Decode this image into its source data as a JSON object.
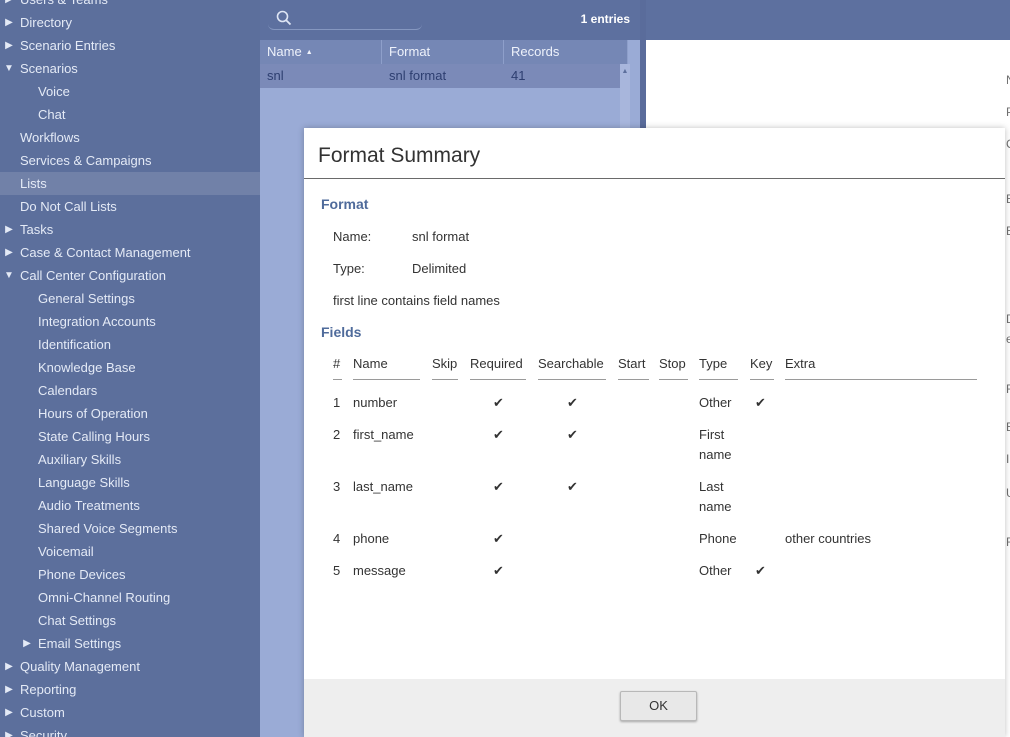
{
  "sidebar": {
    "items": [
      {
        "label": "Users & Teams",
        "arrow": "▶"
      },
      {
        "label": "Directory",
        "arrow": "▶"
      },
      {
        "label": "Scenario Entries",
        "arrow": "▶"
      },
      {
        "label": "Scenarios",
        "arrow": "▼"
      },
      {
        "label": "Voice",
        "arrow": ""
      },
      {
        "label": "Chat",
        "arrow": ""
      },
      {
        "label": "Workflows",
        "arrow": ""
      },
      {
        "label": "Services & Campaigns",
        "arrow": ""
      },
      {
        "label": "Lists",
        "arrow": ""
      },
      {
        "label": "Do Not Call Lists",
        "arrow": ""
      },
      {
        "label": "Tasks",
        "arrow": "▶"
      },
      {
        "label": "Case & Contact Management",
        "arrow": "▶"
      },
      {
        "label": "Call Center Configuration",
        "arrow": "▼"
      },
      {
        "label": "General Settings",
        "arrow": ""
      },
      {
        "label": "Integration Accounts",
        "arrow": ""
      },
      {
        "label": "Identification",
        "arrow": ""
      },
      {
        "label": "Knowledge Base",
        "arrow": ""
      },
      {
        "label": "Calendars",
        "arrow": ""
      },
      {
        "label": "Hours of Operation",
        "arrow": ""
      },
      {
        "label": "State Calling Hours",
        "arrow": ""
      },
      {
        "label": "Auxiliary Skills",
        "arrow": ""
      },
      {
        "label": "Language Skills",
        "arrow": ""
      },
      {
        "label": "Audio Treatments",
        "arrow": ""
      },
      {
        "label": "Shared Voice Segments",
        "arrow": ""
      },
      {
        "label": "Voicemail",
        "arrow": ""
      },
      {
        "label": "Phone Devices",
        "arrow": ""
      },
      {
        "label": "Omni-Channel Routing",
        "arrow": ""
      },
      {
        "label": "Chat Settings",
        "arrow": ""
      },
      {
        "label": "Email Settings",
        "arrow": "▶"
      },
      {
        "label": "Quality Management",
        "arrow": "▶"
      },
      {
        "label": "Reporting",
        "arrow": "▶"
      },
      {
        "label": "Custom",
        "arrow": "▶"
      },
      {
        "label": "Security",
        "arrow": "▶"
      }
    ]
  },
  "list": {
    "search_placeholder": "",
    "entries_label": "1 entries",
    "columns": [
      "Name",
      "Format",
      "Records"
    ],
    "sort_caret": "▲",
    "rows": [
      {
        "name": "snl",
        "format": "snl format",
        "records": "41"
      }
    ],
    "scroll_up": "▲"
  },
  "right_edge_letters": [
    "N",
    "P",
    "C",
    "E",
    "E",
    "D",
    "e",
    "F",
    "E",
    "I",
    "U",
    "F"
  ],
  "modal": {
    "title": "Format Summary",
    "format_section": "Format",
    "name_label": "Name:",
    "name_value": "snl format",
    "type_label": "Type:",
    "type_value": "Delimited",
    "note": "first line contains field names",
    "fields_section": "Fields",
    "columns": [
      "#",
      "Name",
      "Skip",
      "Required",
      "Searchable",
      "Start",
      "Stop",
      "Type",
      "Key",
      "Extra"
    ],
    "check_glyph": "✔",
    "fields": [
      {
        "num": "1",
        "name": "number",
        "skip": "",
        "required": true,
        "searchable": true,
        "start": "",
        "stop": "",
        "type_line1": "Other",
        "type_line2": "",
        "key": true,
        "extra": ""
      },
      {
        "num": "2",
        "name": "first_name",
        "skip": "",
        "required": true,
        "searchable": true,
        "start": "",
        "stop": "",
        "type_line1": "First",
        "type_line2": "name",
        "key": false,
        "extra": ""
      },
      {
        "num": "3",
        "name": "last_name",
        "skip": "",
        "required": true,
        "searchable": true,
        "start": "",
        "stop": "",
        "type_line1": "Last",
        "type_line2": "name",
        "key": false,
        "extra": ""
      },
      {
        "num": "4",
        "name": "phone",
        "skip": "",
        "required": true,
        "searchable": false,
        "start": "",
        "stop": "",
        "type_line1": "Phone",
        "type_line2": "",
        "key": false,
        "extra": "other countries"
      },
      {
        "num": "5",
        "name": "message",
        "skip": "",
        "required": true,
        "searchable": false,
        "start": "",
        "stop": "",
        "type_line1": "Other",
        "type_line2": "",
        "key": true,
        "extra": ""
      }
    ],
    "ok_label": "OK"
  }
}
